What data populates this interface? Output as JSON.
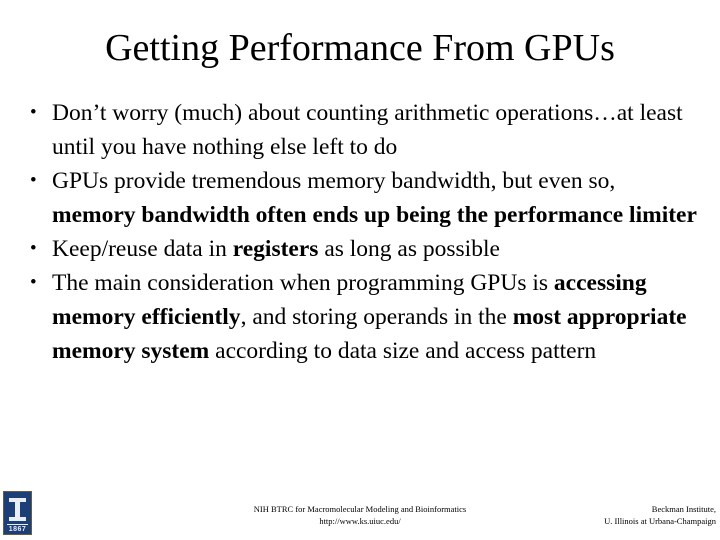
{
  "slide": {
    "background_color": "#ffffff",
    "text_color": "#000000",
    "title": "Getting Performance From GPUs"
  },
  "bullets": [
    {
      "marker": "•",
      "segments": [
        {
          "text": "Don’t worry (much) about counting arithmetic operations…at least until you have nothing else left to do",
          "bold": false
        }
      ]
    },
    {
      "marker": "•",
      "segments": [
        {
          "text": "GPUs provide tremendous memory bandwidth, but even so, ",
          "bold": false
        },
        {
          "text": "memory bandwidth often ends up being the performance limiter",
          "bold": true
        }
      ]
    },
    {
      "marker": "•",
      "segments": [
        {
          "text": "Keep/reuse data in ",
          "bold": false
        },
        {
          "text": "registers",
          "bold": true
        },
        {
          "text": " as long as possible",
          "bold": false
        }
      ]
    },
    {
      "marker": "•",
      "segments": [
        {
          "text": "The main consideration when programming GPUs is ",
          "bold": false
        },
        {
          "text": "accessing memory efficiently",
          "bold": true
        },
        {
          "text": ", and storing operands in the ",
          "bold": false
        },
        {
          "text": "most appropriate memory system",
          "bold": true
        },
        {
          "text": " according to data size and access pattern",
          "bold": false
        }
      ]
    }
  ],
  "footer": {
    "center": {
      "line1": "NIH BTRC for Macromolecular Modeling and Bioinformatics",
      "line2": "http://www.ks.uiuc.edu/"
    },
    "right": {
      "line1": "Beckman Institute,",
      "line2": "U. Illinois at Urbana-Champaign"
    }
  },
  "logo": {
    "name": "university-of-illinois-block-i-logo",
    "letter": "I",
    "year": "1867",
    "background_color": "#1d3f77",
    "mark_color": "#e9eef6",
    "border_color": "#6a5c3a"
  }
}
